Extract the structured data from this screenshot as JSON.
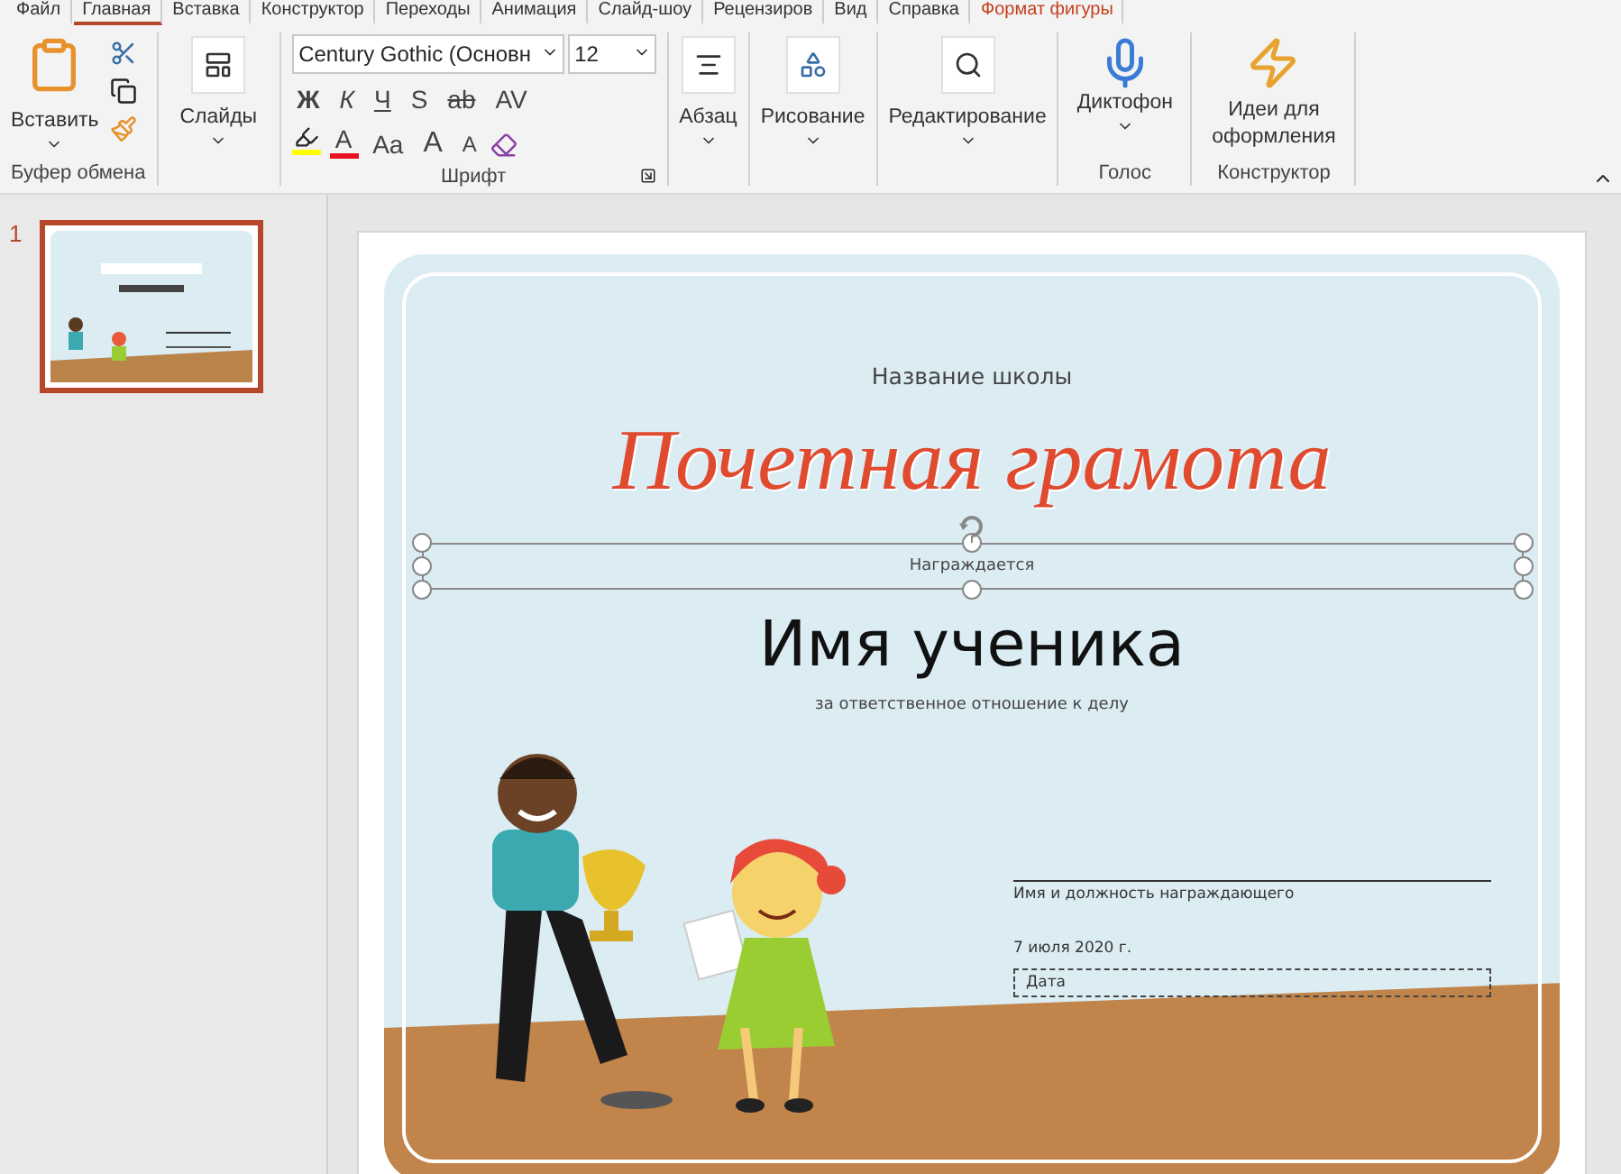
{
  "ribbon_tabs": [
    {
      "label": "Файл",
      "selected": false
    },
    {
      "label": "Главная",
      "selected": true
    },
    {
      "label": "Вставка",
      "selected": false
    },
    {
      "label": "Конструктор",
      "selected": false
    },
    {
      "label": "Переходы",
      "selected": false
    },
    {
      "label": "Анимация",
      "selected": false
    },
    {
      "label": "Слайд-шоу",
      "selected": false
    },
    {
      "label": "Рецензиров",
      "selected": false
    },
    {
      "label": "Вид",
      "selected": false
    },
    {
      "label": "Справка",
      "selected": false
    },
    {
      "label": "Формат фигуры",
      "selected": false,
      "kind": "contextual"
    }
  ],
  "ribbon": {
    "clipboard": {
      "paste": "Вставить",
      "label": "Буфер обмена"
    },
    "slides": {
      "button": "Слайды"
    },
    "font": {
      "label": "Шрифт",
      "font_name": "Century Gothic (Основн",
      "font_size": "12",
      "row_1": [
        {
          "kind": "bold",
          "text": "Ж"
        },
        {
          "kind": "italic",
          "text": "К"
        },
        {
          "kind": "underline",
          "text": "Ч"
        },
        {
          "kind": "shadow",
          "text": "S"
        },
        {
          "kind": "strike",
          "text": "ab"
        },
        {
          "kind": "spacing",
          "text": "AV"
        }
      ],
      "row_2": [
        {
          "kind": "highlight",
          "color": "#ffff00"
        },
        {
          "kind": "color",
          "text": "A",
          "color": "#e81123"
        },
        {
          "kind": "case",
          "text": "Aa"
        },
        {
          "kind": "grow",
          "text": "A"
        },
        {
          "kind": "shrink",
          "text": "A"
        },
        {
          "kind": "clear"
        }
      ]
    },
    "paragraph": {
      "button": "Абзац"
    },
    "drawing": {
      "button": "Рисование"
    },
    "editing": {
      "button": "Редактирование"
    },
    "voice": {
      "button": "Диктофон",
      "label": "Голос"
    },
    "designer": {
      "button": "Идеи для оформления",
      "label": "Конструктор"
    }
  },
  "thumbnails": [
    {
      "number": "1",
      "selected": true
    }
  ],
  "slide": {
    "school": "Название школы",
    "title": "Почетная грамота",
    "awarded": "Награждается",
    "student": "Имя ученика",
    "reason": "за ответственное отношение к делу",
    "signer": "Имя и должность награждающего",
    "date": "7 июля 2020 г.",
    "date_label": "Дата"
  }
}
